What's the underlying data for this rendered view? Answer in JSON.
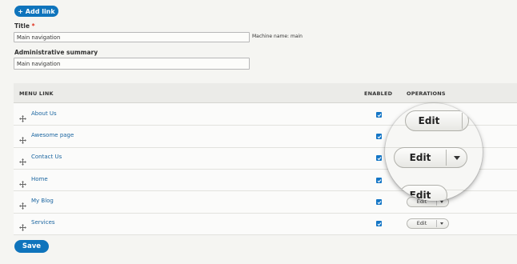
{
  "toolbar": {
    "add_link_label": "+ Add link"
  },
  "form": {
    "title_label": "Title",
    "required_mark": "*",
    "title_value": "Main navigation",
    "machine_name": "Machine name: main",
    "summary_label": "Administrative summary",
    "summary_value": "Main navigation"
  },
  "table": {
    "headers": {
      "menu_link": "MENU LINK",
      "enabled": "ENABLED",
      "operations": "OPERATIONS"
    },
    "rows": [
      {
        "label": "About Us",
        "enabled": true,
        "op": "Edit"
      },
      {
        "label": "Awesome page",
        "enabled": true,
        "op": "Edit"
      },
      {
        "label": "Contact Us",
        "enabled": true,
        "op": "Edit"
      },
      {
        "label": "Home",
        "enabled": true,
        "op": "Edit"
      },
      {
        "label": "My Blog",
        "enabled": true,
        "op": "Edit"
      },
      {
        "label": "Services",
        "enabled": true,
        "op": "Edit"
      }
    ]
  },
  "magnifier": {
    "edit_label": "Edit"
  },
  "footer": {
    "save_label": "Save"
  },
  "colors": {
    "accent": "#0f74bc",
    "link": "#1a65a0",
    "required": "#e0301e"
  }
}
